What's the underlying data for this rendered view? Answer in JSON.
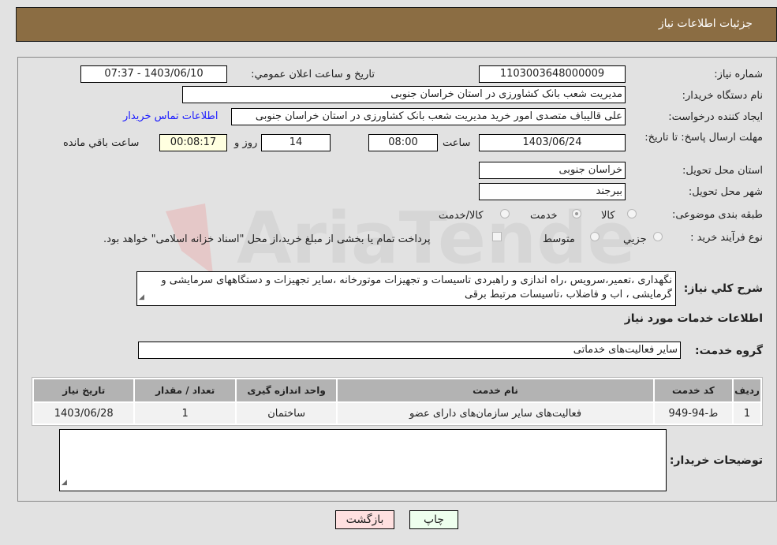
{
  "header": {
    "title": "جزئیات اطلاعات نیاز"
  },
  "fields": {
    "need_number": {
      "label": "شماره نیاز:",
      "value": "1103003648000009"
    },
    "announce_datetime": {
      "label": "تاریخ و ساعت اعلان عمومي:",
      "value": "1403/06/10 - 07:37"
    },
    "buyer_org": {
      "label": "نام دستگاه خريدار:",
      "value": "مدیریت شعب بانک کشاورزی در استان خراسان جنوبی"
    },
    "requester": {
      "label": "ایجاد کننده درخواست:",
      "value": "علی قالیباف متصدی امور خرید مدیریت شعب بانک کشاورزی در استان خراسان جنوبی"
    },
    "contact_link": "اطلاعات تماس خریدار",
    "deadline": {
      "label": "مهلت ارسال پاسخ: تا تاریخ:",
      "date": "1403/06/24",
      "time_label": "ساعت",
      "time": "08:00",
      "days": "14",
      "days_label": "روز و",
      "remaining": "00:08:17",
      "remaining_label": "ساعت باقي مانده"
    },
    "delivery_province": {
      "label": "استان محل تحویل:",
      "value": "خراسان جنوبی"
    },
    "delivery_city": {
      "label": "شهر محل تحویل:",
      "value": "بیرجند"
    },
    "category": {
      "label": "طبقه بندی موضوعی:",
      "options": [
        "کالا",
        "خدمت",
        "کالا/خدمت"
      ],
      "selected": "خدمت"
    },
    "purchase_type": {
      "label": "نوع فرآیند خرید :",
      "options": [
        "جزيي",
        "متوسط"
      ],
      "selected": "متوسط",
      "payment_note": "پرداخت تمام یا بخشی از مبلغ خرید،از محل \"اسناد خزانه اسلامی\" خواهد بود."
    }
  },
  "description": {
    "label": "شرح کلي نياز:",
    "value": "نگهداری ،تعمیر،سرویس ،راه اندازی و راهبردی تاسیسات و تجهیزات موتورخانه ،سایر تجهیزات و دستگاههای سرمایشی و گرمایشی ، اب و فاضلاب ،تاسیسات مرتبط برقی"
  },
  "services_section": {
    "title": "اطلاعات خدمات مورد نياز",
    "group_label": "گروه خدمت:",
    "group_value": "سایر فعالیت‌های خدماتی",
    "table": {
      "headers": [
        "رديف",
        "کد خدمت",
        "نام خدمت",
        "واحد اندازه گيری",
        "تعداد / مقدار",
        "تاريخ نياز"
      ],
      "rows": [
        [
          "1",
          "ط-94-949",
          "فعالیت‌های سایر سازمان‌های دارای عضو",
          "ساختمان",
          "1",
          "1403/06/28"
        ]
      ]
    }
  },
  "buyer_notes": {
    "label": "توضيحات خريدار:",
    "value": ""
  },
  "buttons": {
    "print": "چاپ",
    "back": "بازگشت"
  },
  "colors": {
    "header_bg": "#8b6d43",
    "link": "#1a1aff",
    "print_bg": "#eeffee",
    "back_bg": "#ffe0e0",
    "remaining_bg": "#ffffe0"
  }
}
